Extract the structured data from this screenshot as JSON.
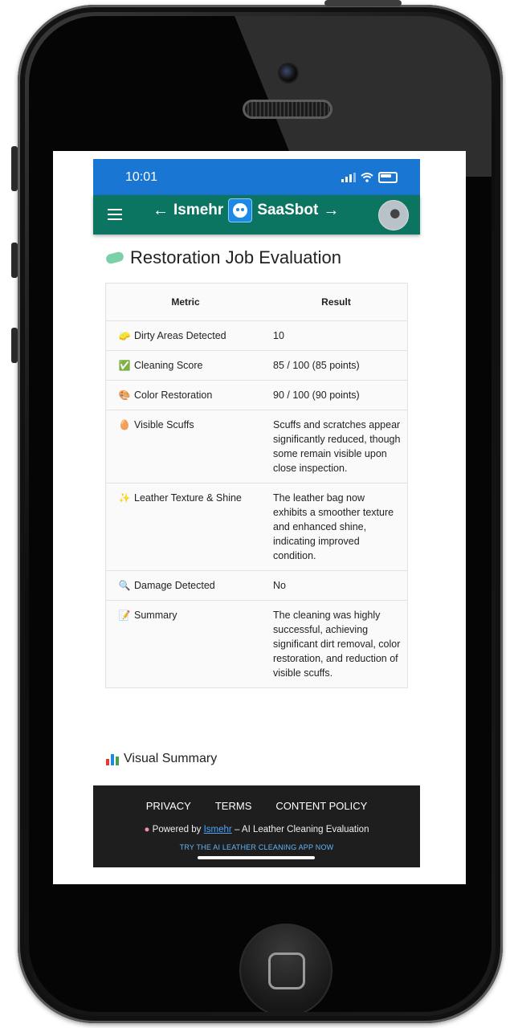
{
  "status": {
    "time": "10:01"
  },
  "appbar": {
    "brand_left": "Ismehr",
    "brand_right": "SaaSbot",
    "arrow_left": "←",
    "arrow_right": "→"
  },
  "page": {
    "title": "Restoration Job Evaluation"
  },
  "table": {
    "headers": [
      "Metric",
      "Result"
    ],
    "rows": [
      {
        "icon": "🧽",
        "metric": "Dirty Areas Detected",
        "result": "10"
      },
      {
        "icon": "✅",
        "metric": "Cleaning Score",
        "result": "85 / 100 (85 points)"
      },
      {
        "icon": "🎨",
        "metric": "Color Restoration",
        "result": "90 / 100 (90 points)"
      },
      {
        "icon": "🥚",
        "metric": "Visible Scuffs",
        "result": "Scuffs and scratches appear significantly reduced, though some remain visible upon close inspection."
      },
      {
        "icon": "✨",
        "metric": "Leather Texture & Shine",
        "result": "The leather bag now exhibits a smoother texture and enhanced shine, indicating improved condition."
      },
      {
        "icon": "🔍",
        "metric": "Damage Detected",
        "result": "No"
      },
      {
        "icon": "📝",
        "metric": "Summary",
        "result": "The cleaning was highly successful, achieving significant dirt removal, color restoration, and reduction of visible scuffs."
      }
    ]
  },
  "visual_summary": {
    "title": "Visual Summary"
  },
  "footer": {
    "links": [
      "PRIVACY",
      "TERMS",
      "CONTENT POLICY"
    ],
    "powered_prefix": "Powered by",
    "powered_link": "Ismehr",
    "powered_suffix": "– AI Leather Cleaning Evaluation",
    "cta": "TRY THE AI LEATHER CLEANING APP NOW"
  },
  "colors": {
    "status_bar": "#1976d2",
    "app_bar": "#0b7561",
    "footer": "#1e1e1e",
    "link": "#4aa3ff"
  },
  "icons": {
    "menu": "hamburger-icon",
    "avatar": "user-avatar",
    "logo": "robot-logo-icon",
    "chart": "bar-chart-icon"
  }
}
